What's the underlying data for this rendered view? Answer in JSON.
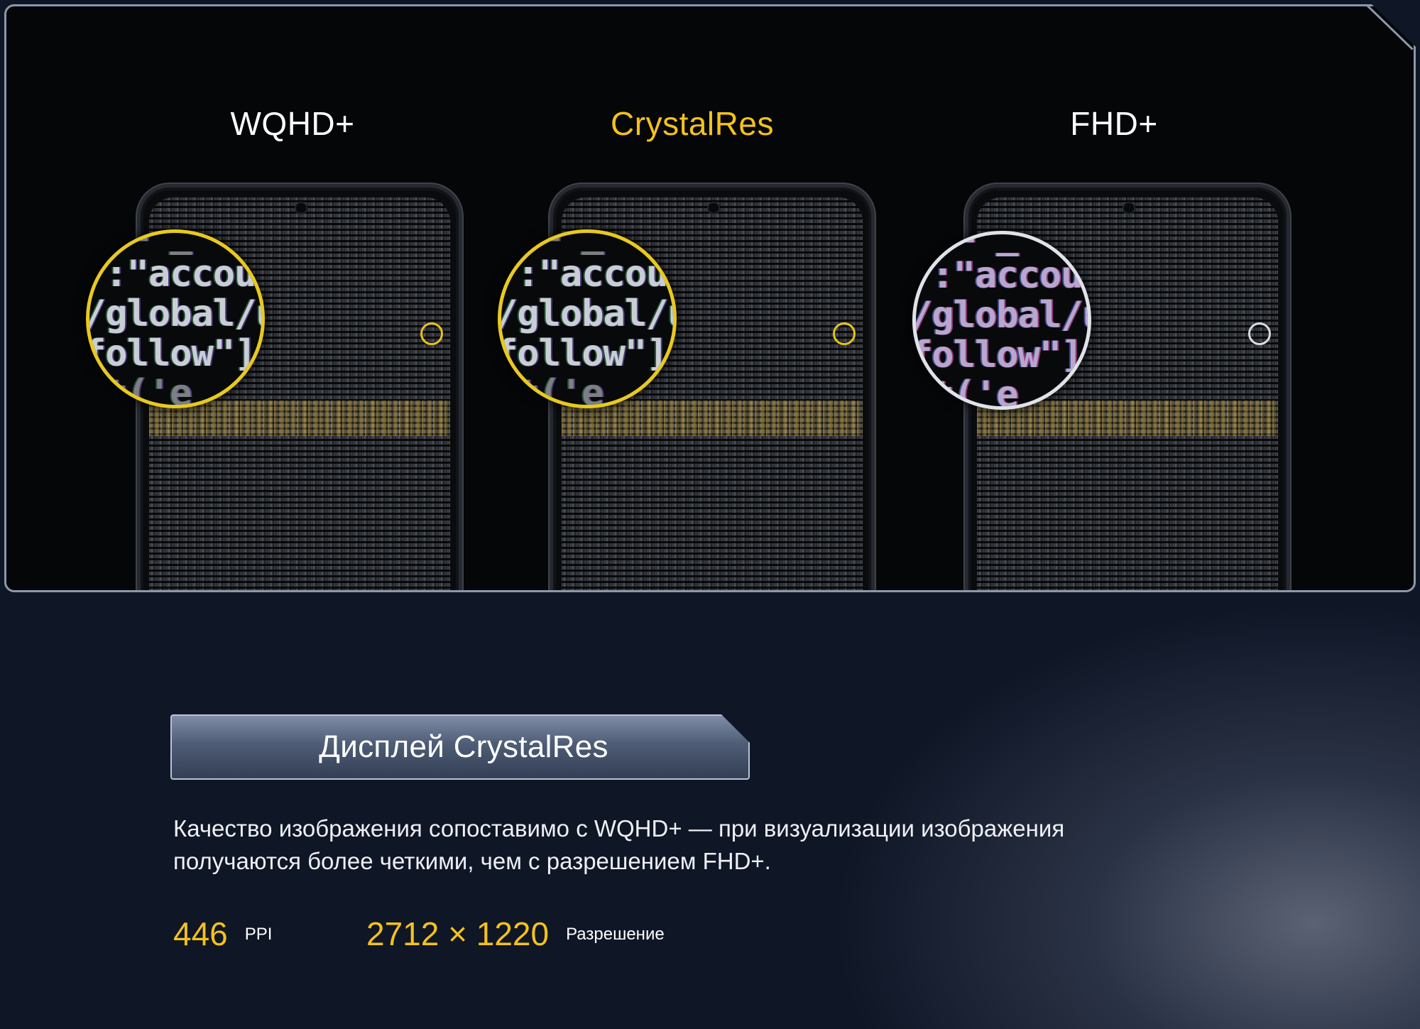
{
  "showcase": {
    "variants": [
      {
        "title": "WQHD+",
        "accent": false,
        "magnified_text": [
          "e(=\"_",
          "\":\"accou",
          "/global/u",
          "follow\"])",
          "et('e"
        ]
      },
      {
        "title": "CrystalRes",
        "accent": true,
        "magnified_text": [
          "e(=\"_",
          "\":\"accou",
          "/global/u",
          "follow\"])",
          "et('e"
        ]
      },
      {
        "title": "FHD+",
        "accent": false,
        "magnified_text": [
          "e(=\"_",
          "\":\"accou",
          "/global/u",
          "follow\"])",
          "et('e"
        ]
      }
    ]
  },
  "feature": {
    "title": "Дисплей CrystalRes",
    "description": [
      "Качество изображения сопоставимо с WQHD+ — при визуализации изображения",
      "получаются более четкими, чем с разрешением FHD+."
    ],
    "specs": [
      {
        "value": "446",
        "unit": "PPI"
      },
      {
        "value": "2712 × 1220",
        "unit": "Разрешение"
      }
    ]
  },
  "colors": {
    "accent": "#f5c21b",
    "ring_yellow": "#e8c91e",
    "ring_white": "#dfe3e9",
    "background": "#0c1220",
    "frame_border": "#8c98aa"
  }
}
